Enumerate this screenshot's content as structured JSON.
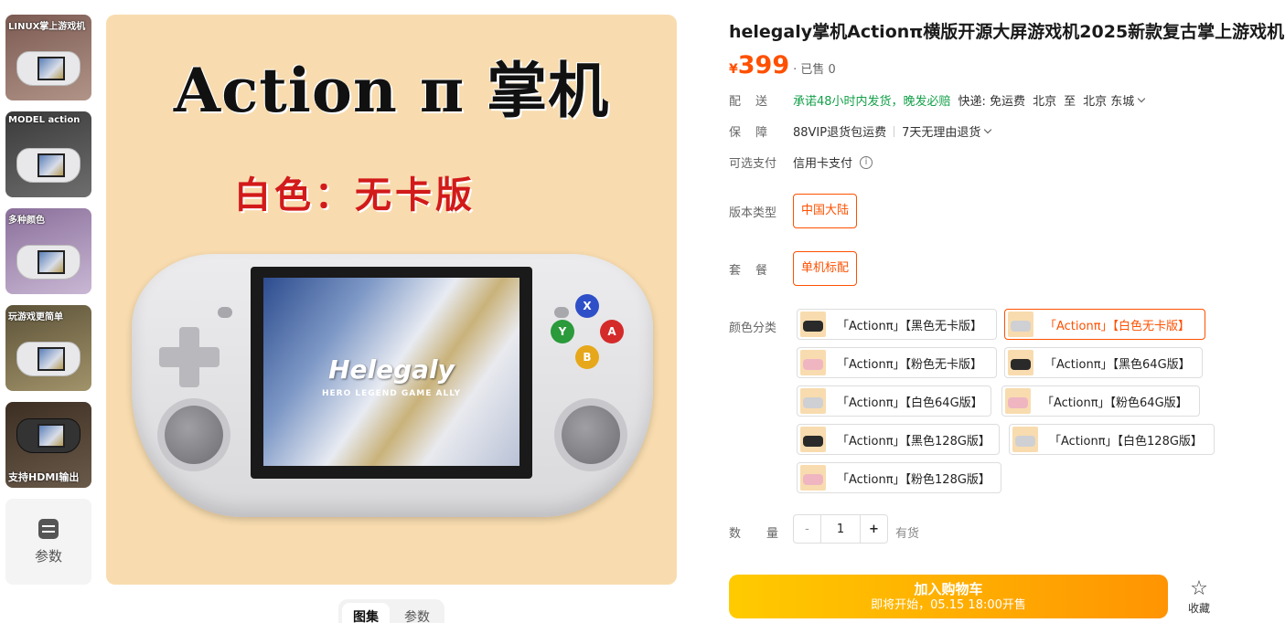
{
  "thumbnails": [
    {
      "caption": "LINUX掌上游戏机"
    },
    {
      "caption": "MODEL action"
    },
    {
      "caption": "多种颜色"
    },
    {
      "caption": "玩游戏更简单"
    },
    {
      "caption": "支持HDMI输出"
    }
  ],
  "params_thumb": {
    "label": "参数",
    "icon": "sliders-icon"
  },
  "main_image": {
    "title": "Action π 掌机",
    "subtitle": "白色：无卡版",
    "screen_brand": "Helegaly",
    "screen_tagline": "HERO LEGEND GAME ALLY",
    "buttons": {
      "x": "X",
      "y": "Y",
      "a": "A",
      "b": "B"
    }
  },
  "gallery_tabs": [
    "图集",
    "参数"
  ],
  "product": {
    "title": "helegaly掌机Actionπ横版开源大屏游戏机2025新款复古掌上游戏机",
    "currency": "¥",
    "price": "399",
    "sold": "· 已售 0"
  },
  "delivery": {
    "label": "配送",
    "promise": "承诺48小时内发货，晚发必赔",
    "express": "快递: 免运费",
    "from": "北京",
    "to_word": "至",
    "to": "北京 东城"
  },
  "guarantee": {
    "label": "保障",
    "item1": "88VIP退货包运费",
    "item2": "7天无理由退货"
  },
  "payment": {
    "label": "可选支付",
    "value": "信用卡支付"
  },
  "version": {
    "label": "版本类型",
    "option": "中国大陆"
  },
  "package": {
    "label": "套餐",
    "option": "单机标配"
  },
  "colors": {
    "label": "颜色分类",
    "options": [
      "「Actionπ」【黑色无卡版】",
      "「Actionπ」【白色无卡版】",
      "「Actionπ」【粉色无卡版】",
      "「Actionπ」【黑色64G版】",
      "「Actionπ」【白色64G版】",
      "「Actionπ」【粉色64G版】",
      "「Actionπ」【黑色128G版】",
      "「Actionπ」【白色128G版】",
      "「Actionπ」【粉色128G版】"
    ],
    "selected": "「Actionπ」【白色无卡版】"
  },
  "quantity": {
    "label": "数量",
    "value": "1",
    "minus": "-",
    "plus": "+",
    "stock": "有货"
  },
  "cart": {
    "line1": "加入购物车",
    "line2": "即将开始，05.15 18:00开售"
  },
  "favorite": {
    "label": "收藏",
    "icon": "star-icon"
  },
  "accent_color": "#ff5000",
  "promise_color": "#13a049"
}
